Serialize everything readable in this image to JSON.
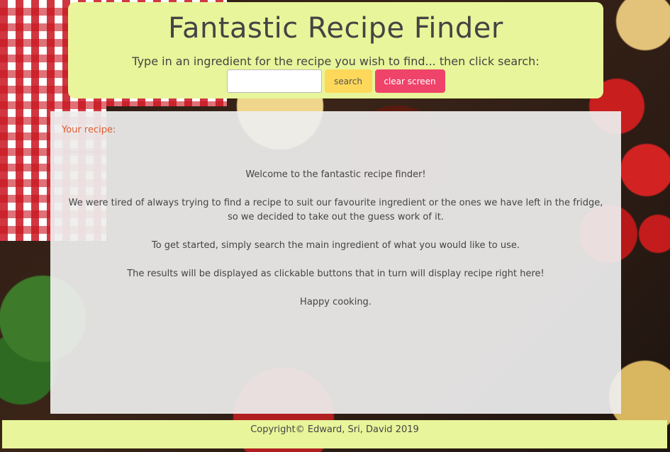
{
  "header": {
    "title": "Fantastic Recipe Finder",
    "subtitle": "Type in an ingredient for the recipe you wish to find... then click search:",
    "search_input": {
      "value": "",
      "placeholder": ""
    },
    "search_button_label": "search",
    "clear_button_label": "clear screen"
  },
  "panel": {
    "heading": "Your recipe:",
    "paragraphs": [
      "Welcome to the fantastic recipe finder!",
      "We were tired of always trying to find a recipe to suit our favourite ingredient or the ones we have left in the fridge, so we decided to take out the guess work of it.",
      "To get started, simply search the main ingredient of what you would like to use.",
      "The results will be displayed as clickable buttons that in turn will display recipe right here!",
      "Happy cooking."
    ]
  },
  "footer": {
    "copyright": "Copyright© Edward, Sri, David 2019"
  },
  "colors": {
    "header_bg": "#e8f59a",
    "search_button": "#fdd85a",
    "clear_button": "#f0436a",
    "heading_accent": "#e0592f"
  }
}
